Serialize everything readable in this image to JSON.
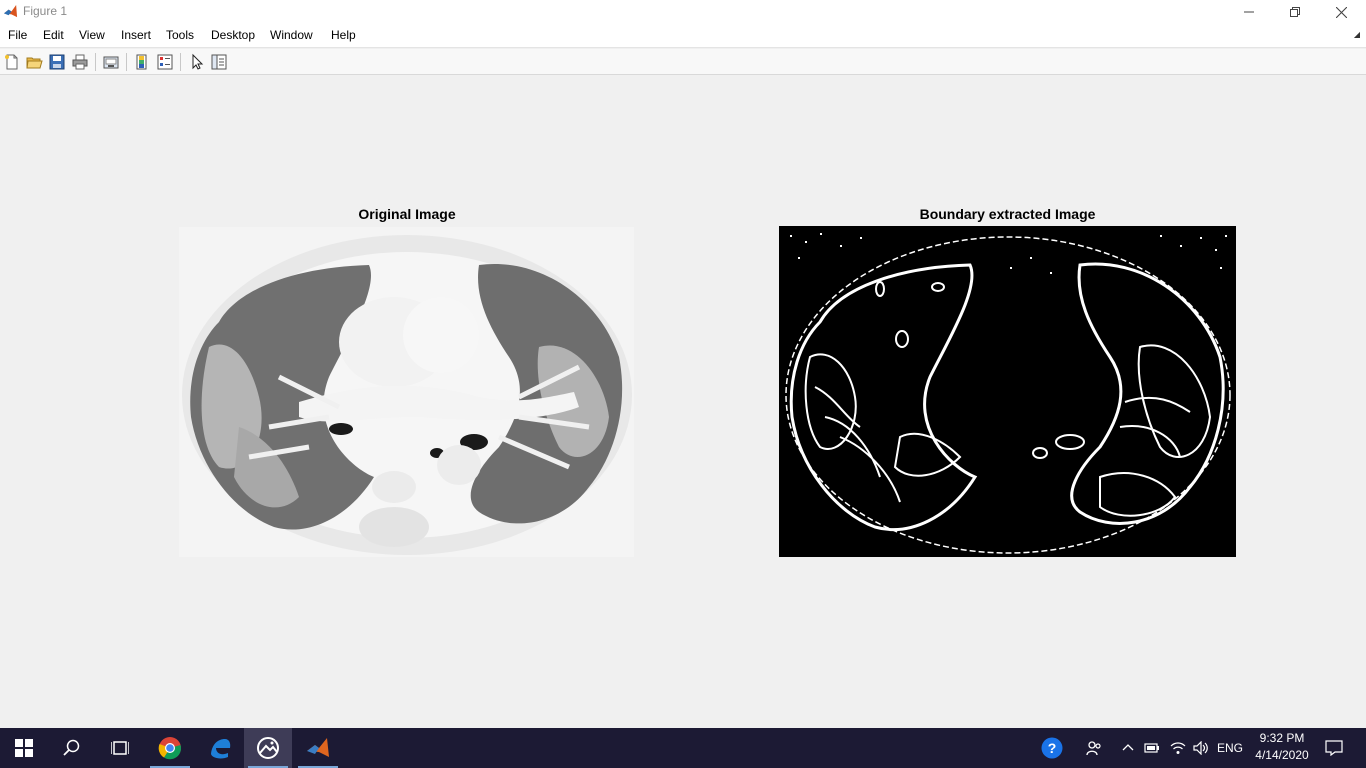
{
  "window": {
    "title": "Figure 1"
  },
  "menu": {
    "items": [
      "File",
      "Edit",
      "View",
      "Insert",
      "Tools",
      "Desktop",
      "Window",
      "Help"
    ]
  },
  "toolbar": {
    "buttons": [
      "new-figure-icon",
      "open-file-icon",
      "save-icon",
      "print-icon",
      "link-plot-icon",
      "insert-colorbar-icon",
      "insert-legend-icon",
      "edit-plot-arrow-icon",
      "property-inspector-icon"
    ]
  },
  "figure": {
    "left_title": "Original Image",
    "right_title": "Boundary extracted Image"
  },
  "taskbar": {
    "apps": [
      "start-icon",
      "search-icon",
      "task-view-icon",
      "chrome-icon",
      "edge-icon",
      "photos-icon",
      "matlab-icon"
    ],
    "active_app": "photos-icon",
    "language": "ENG",
    "time": "9:32 PM",
    "date": "4/14/2020"
  },
  "colors": {
    "taskbar_bg": "#1c1a34",
    "help_blue": "#1a73e8"
  }
}
